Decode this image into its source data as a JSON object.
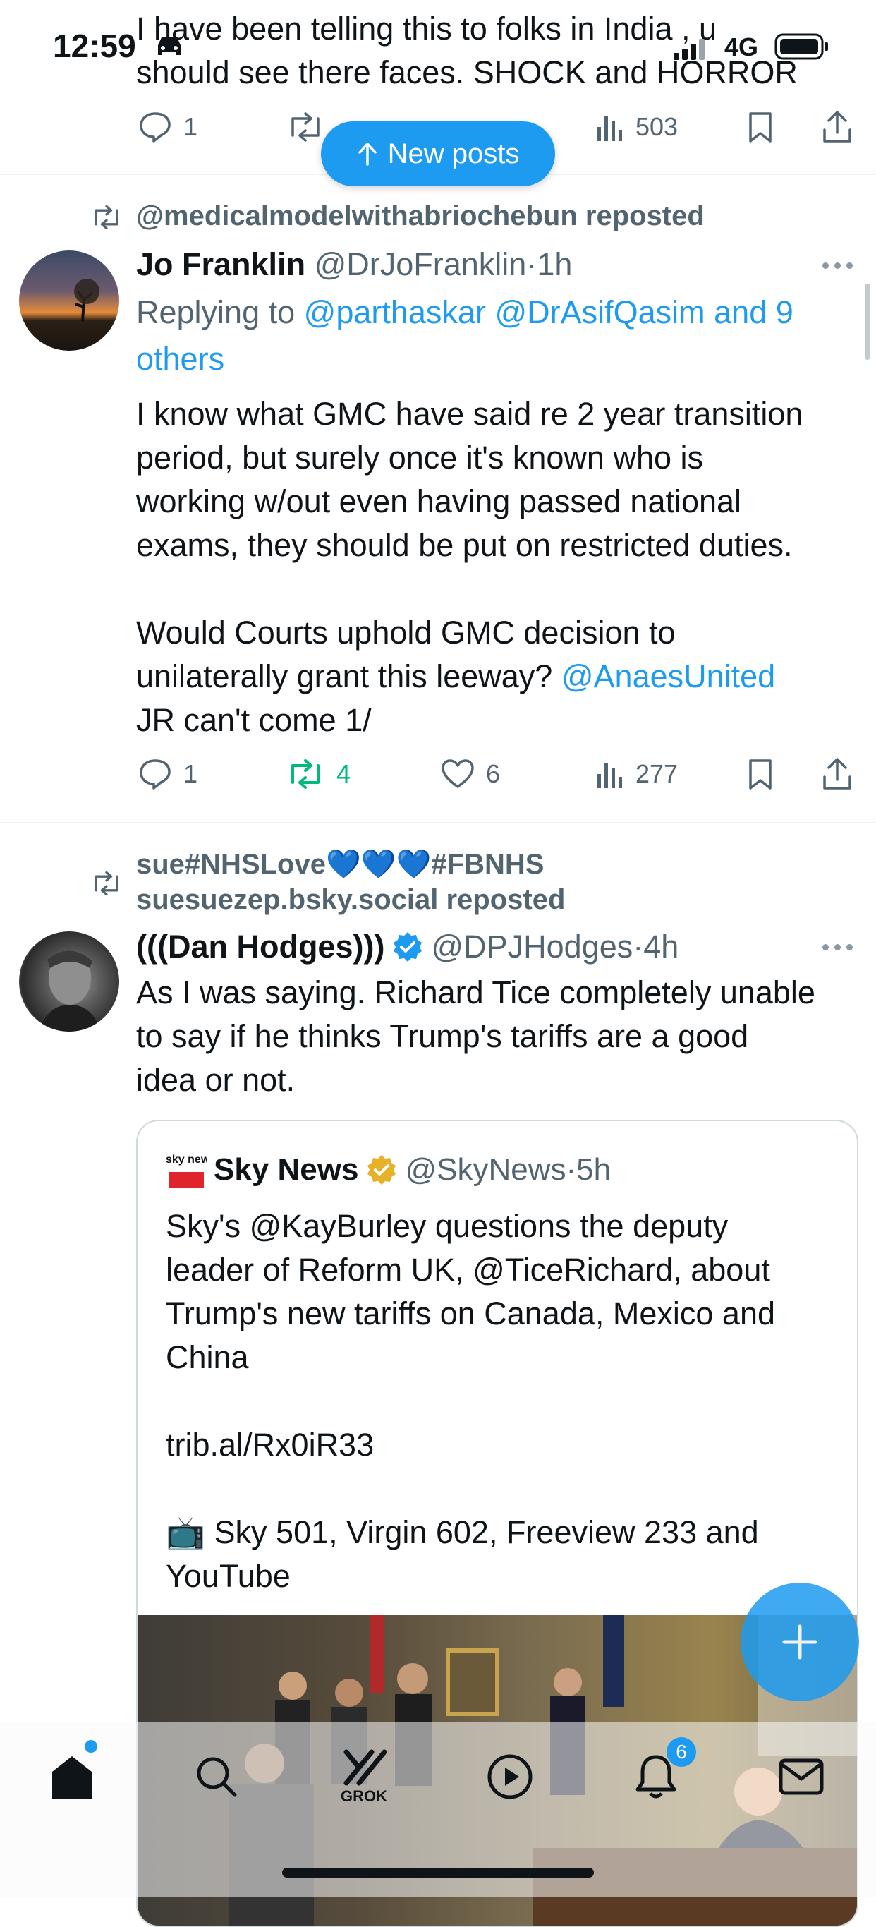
{
  "status_bar": {
    "time": "12:59",
    "network": "4G"
  },
  "top_post": {
    "text_line1": "I have been telling this to folks in India , u",
    "text_line2": "should see there faces. SHOCK and HORROR",
    "replies": "1",
    "views": "503"
  },
  "new_posts_label": "New posts",
  "post1": {
    "repost_label": "@medicalmodelwithabriochebun reposted",
    "author_name": "Jo Franklin",
    "author_handle": "@DrJoFranklin",
    "time": "1h",
    "replying_prefix": "Replying to",
    "replying_targets": "@parthaskar @DrAsifQasim and 9",
    "replying_suffix": "others",
    "lines": [
      "I know what GMC have said re 2 year transition",
      "period, but surely once it's known who is",
      "working w/out even having passed national",
      "exams, they should be put on restricted duties."
    ],
    "line5": "Would Courts uphold GMC decision to",
    "line6_prefix": "unilaterally grant this leeway?",
    "line6_mention": "@AnaesUnited",
    "line7": "JR can't come 1/",
    "replies": "1",
    "reposts": "4",
    "likes": "6",
    "views": "277"
  },
  "post2": {
    "repost_line1": "sue#NHSLove💙💙💙#FBNHS",
    "repost_line2": "suesuezep.bsky.social reposted",
    "author_name": "(((Dan Hodges)))",
    "author_handle": "@DPJHodges",
    "time": "4h",
    "lines": [
      "As I was saying. Richard Tice completely unable",
      "to say if he thinks Trump's tariffs are a good",
      "idea or not."
    ]
  },
  "quote": {
    "logo_text": "sky news",
    "author_name": "Sky News",
    "author_handle": "@SkyNews",
    "time": "5h",
    "lines": [
      "Sky's @KayBurley questions the deputy",
      "leader of Reform UK, @TiceRichard, about",
      "Trump's new tariffs on Canada, Mexico and",
      "China"
    ],
    "link": "trib.al/Rx0iR33",
    "tv_line1": "📺 Sky 501, Virgin 602, Freeview 233 and",
    "tv_line2": "YouTube"
  },
  "tab_bar": {
    "grok_label": "GROK",
    "notification_count": "6"
  },
  "colors": {
    "accent": "#1d9bf0",
    "repost_green": "#00ba7c",
    "muted": "#536471"
  }
}
